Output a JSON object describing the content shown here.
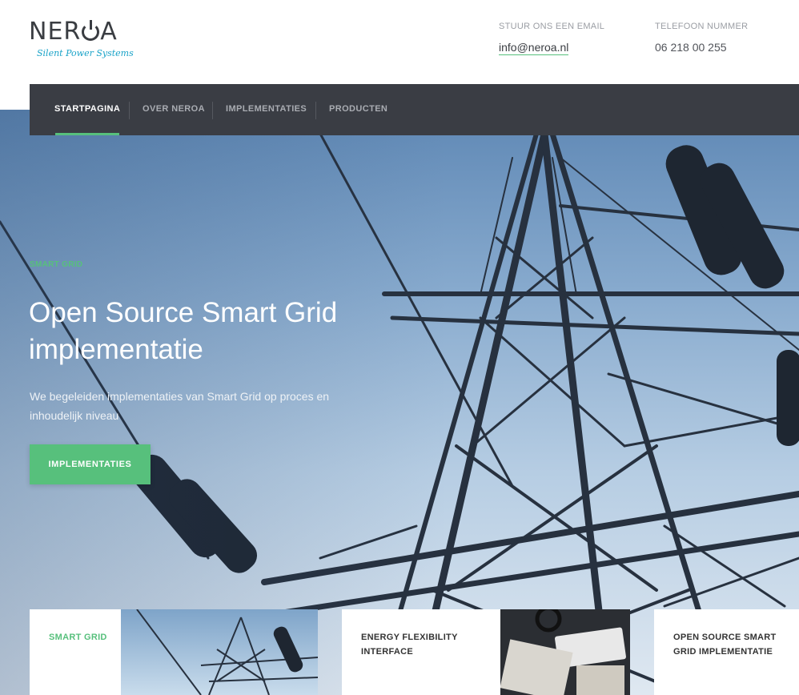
{
  "brand": {
    "logo_prefix": "NER",
    "logo_suffix": "A",
    "tagline": "Silent Power Systems"
  },
  "contact": {
    "email_label": "STUUR ONS EEN EMAIL",
    "email_value": "info@neroa.nl",
    "phone_label": "TELEFOON NUMMER",
    "phone_value": "06 218 00 255"
  },
  "nav": {
    "items": [
      {
        "label": "STARTPAGINA",
        "active": true
      },
      {
        "label": "OVER NEROA",
        "active": false
      },
      {
        "label": "IMPLEMENTATIES",
        "active": false
      },
      {
        "label": "PRODUCTEN",
        "active": false
      }
    ]
  },
  "hero": {
    "kicker": "SMART GRID",
    "title": "Open Source Smart Grid implementatie",
    "subtitle": "We begeleiden implementaties van Smart Grid op proces en inhoudelijk niveau",
    "button_label": "IMPLEMENTATIES"
  },
  "cards": [
    {
      "title": "SMART GRID"
    },
    {
      "title": "ENERGY FLEXIBILITY INTERFACE"
    },
    {
      "title": "OPEN SOURCE SMART GRID IMPLEMENTATIE"
    }
  ],
  "colors": {
    "accent": "#57c07c",
    "nav_bg": "#3a3d44",
    "text_dark": "#3a3d42",
    "tagline": "#1aa3c8"
  }
}
